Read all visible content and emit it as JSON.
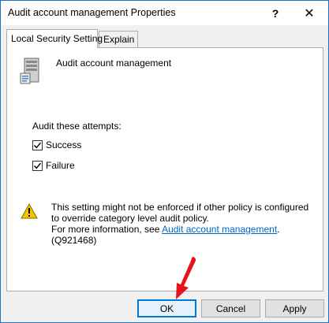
{
  "window": {
    "title": "Audit account management Properties",
    "help_glyph": "?",
    "close_glyph": "✕"
  },
  "tabs": [
    {
      "label": "Local Security Setting",
      "active": true
    },
    {
      "label": "Explain",
      "active": false
    }
  ],
  "policy": {
    "name": "Audit account management",
    "icon": "server-policy-icon"
  },
  "audit": {
    "label": "Audit these attempts:",
    "options": [
      {
        "label": "Success",
        "checked": true
      },
      {
        "label": "Failure",
        "checked": true
      }
    ]
  },
  "warning": {
    "icon": "warning-icon",
    "line1": "This setting might not be enforced if other policy is configured to override category level audit policy.",
    "more_prefix": "For more information, see ",
    "link_text": "Audit account management",
    "more_suffix": ". (Q921468)"
  },
  "buttons": {
    "ok": "OK",
    "cancel": "Cancel",
    "apply": "Apply"
  },
  "colors": {
    "accent": "#0078d7",
    "link": "#0066cc",
    "annotation_arrow": "#e3141b"
  }
}
